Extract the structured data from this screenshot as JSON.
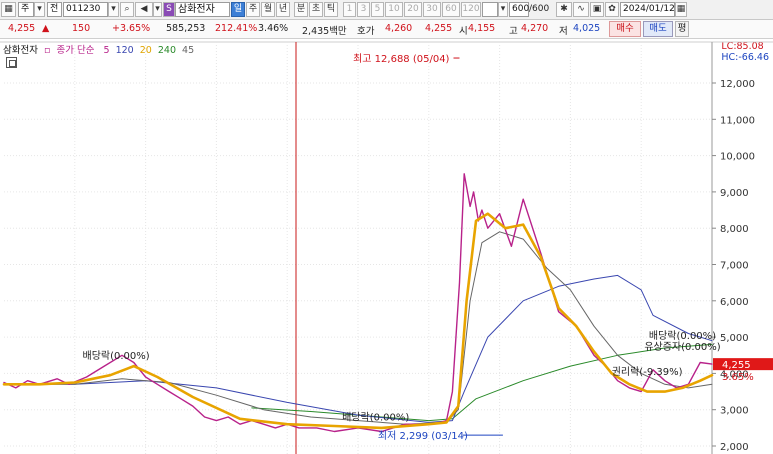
{
  "toolbar": {
    "type_label": "주",
    "market_label": "전",
    "code": "011230",
    "stock_name": "삼화전자",
    "periods": [
      "일",
      "주",
      "월",
      "년",
      "분",
      "초",
      "틱"
    ],
    "active_period": "일",
    "intervals": [
      "1",
      "3",
      "5",
      "10",
      "20",
      "30",
      "60",
      "120"
    ],
    "count": "600",
    "count_total": "/600",
    "date": "2024/01/12"
  },
  "quote": {
    "price": "4,255",
    "change": "150",
    "change_pct": "+3.65%",
    "volume": "585,253",
    "volume_pct": "212.41%",
    "turnover": "3.46%",
    "amount": "2,435백만",
    "hoga_label": "호가",
    "ask": "4,260",
    "bid": "4,255",
    "open_label": "시",
    "open": "4,155",
    "high_label": "고",
    "high": "4,270",
    "low_label": "저",
    "low": "4,025",
    "buy_label": "매수",
    "sell_label": "매도",
    "eval_label": "평"
  },
  "legend": {
    "name": "삼화전자",
    "desc": "종가 단순",
    "ma": [
      {
        "period": "5",
        "color": "#b8228a"
      },
      {
        "period": "120",
        "color": "#3a47b0"
      },
      {
        "period": "20",
        "color": "#e0a500"
      },
      {
        "period": "240",
        "color": "#2a8a2a"
      },
      {
        "period": "45",
        "color": "#666666"
      }
    ]
  },
  "lc_label": "LC:85.08",
  "hc_label": "HC:-66.46",
  "chart_data": {
    "type": "line",
    "ylim": [
      2000,
      12800
    ],
    "yticks": [
      2000,
      3000,
      4000,
      5000,
      6000,
      7000,
      8000,
      9000,
      10000,
      11000,
      12000
    ],
    "ytick_labels": [
      "2,000",
      "3,000",
      "4,000",
      "5,000",
      "6,000",
      "7,000",
      "8,000",
      "9,000",
      "10,000",
      "11,000",
      "12,000"
    ],
    "x_count": 600,
    "last_price": 4255,
    "last_price_label": "4,255",
    "last_change_label": "3.65%",
    "price": {
      "x": [
        0,
        10,
        20,
        30,
        45,
        55,
        70,
        85,
        100,
        110,
        115,
        120,
        125,
        130,
        140,
        150,
        160,
        170,
        180,
        190,
        200,
        210,
        220,
        230,
        240,
        250,
        265,
        280,
        300,
        320,
        340,
        360,
        370,
        375,
        380,
        386,
        390,
        395,
        398,
        402,
        405,
        410,
        420,
        430,
        440,
        455,
        470,
        485,
        500,
        510,
        520,
        530,
        540,
        550,
        560,
        570,
        580,
        590,
        600
      ],
      "values": [
        3750,
        3600,
        3800,
        3700,
        3850,
        3700,
        3900,
        4200,
        4500,
        4300,
        4100,
        3900,
        3800,
        3700,
        3500,
        3300,
        3100,
        2800,
        2700,
        2800,
        2600,
        2700,
        2600,
        2500,
        2600,
        2500,
        2500,
        2400,
        2500,
        2400,
        2600,
        2600,
        2650,
        2700,
        3500,
        6500,
        9500,
        8600,
        9000,
        8200,
        8500,
        8000,
        8400,
        7500,
        8800,
        7300,
        5700,
        5300,
        4500,
        4200,
        3800,
        3600,
        3500,
        4100,
        3800,
        3600,
        3700,
        4300,
        4255
      ]
    },
    "ma20": {
      "x": [
        0,
        30,
        60,
        90,
        110,
        130,
        160,
        200,
        240,
        280,
        320,
        360,
        375,
        385,
        392,
        400,
        410,
        425,
        440,
        455,
        470,
        485,
        500,
        515,
        530,
        545,
        560,
        575,
        590,
        600
      ],
      "values": [
        3700,
        3700,
        3750,
        3950,
        4200,
        3900,
        3350,
        2750,
        2600,
        2550,
        2500,
        2600,
        2650,
        3100,
        6000,
        8200,
        8400,
        8000,
        8100,
        7200,
        5800,
        5300,
        4600,
        4000,
        3700,
        3500,
        3500,
        3600,
        3800,
        3950
      ]
    },
    "ma45": {
      "x": [
        0,
        60,
        100,
        140,
        180,
        220,
        260,
        300,
        340,
        375,
        385,
        395,
        405,
        420,
        440,
        460,
        480,
        500,
        520,
        540,
        560,
        580,
        600
      ],
      "values": [
        3700,
        3700,
        3850,
        3750,
        3400,
        3000,
        2800,
        2700,
        2600,
        2650,
        3000,
        6000,
        7600,
        7900,
        7700,
        6900,
        6300,
        5300,
        4500,
        4000,
        3700,
        3600,
        3700
      ]
    },
    "ma120": {
      "x": [
        0,
        60,
        120,
        180,
        240,
        300,
        360,
        380,
        390,
        410,
        440,
        470,
        500,
        520,
        540,
        550,
        580,
        600
      ],
      "values": [
        3700,
        3700,
        3800,
        3600,
        3200,
        2850,
        2650,
        2700,
        3500,
        5000,
        6000,
        6400,
        6600,
        6700,
        6300,
        5600,
        5100,
        4900
      ]
    },
    "ma240": {
      "x": [
        210,
        260,
        320,
        360,
        380,
        400,
        440,
        480,
        520,
        560,
        600
      ],
      "values": [
        3050,
        2950,
        2800,
        2700,
        2750,
        3300,
        3800,
        4200,
        4500,
        4700,
        4800
      ]
    },
    "annotations": [
      {
        "text": "최고 12,688 (05/04)",
        "x": 386,
        "value": 12688,
        "color": "#d0121b"
      },
      {
        "text": "최저 2,299 (03/14)",
        "x": 355,
        "value": 2299,
        "color": "#1d45c0"
      },
      {
        "text": "배당락(0.00%)",
        "x": 95,
        "value": 4400,
        "color": "#222222"
      },
      {
        "text": "배당락(0.00%)",
        "x": 315,
        "value": 2700,
        "color": "#222222"
      },
      {
        "text": "권리락(-9.39%)",
        "x": 545,
        "value": 3950,
        "color": "#222222"
      },
      {
        "text": "배당락(0.00%)",
        "x": 575,
        "value": 4950,
        "color": "#222222"
      },
      {
        "text": "유상증자(0.00%)",
        "x": 575,
        "value": 4650,
        "color": "#222222"
      }
    ]
  },
  "icons": {
    "menu": "menu-icon",
    "search": "search-icon",
    "sound": "speaker-icon",
    "settings": "gear-icon",
    "calendar": "calendar-icon",
    "save": "save-icon",
    "print": "print-icon"
  }
}
